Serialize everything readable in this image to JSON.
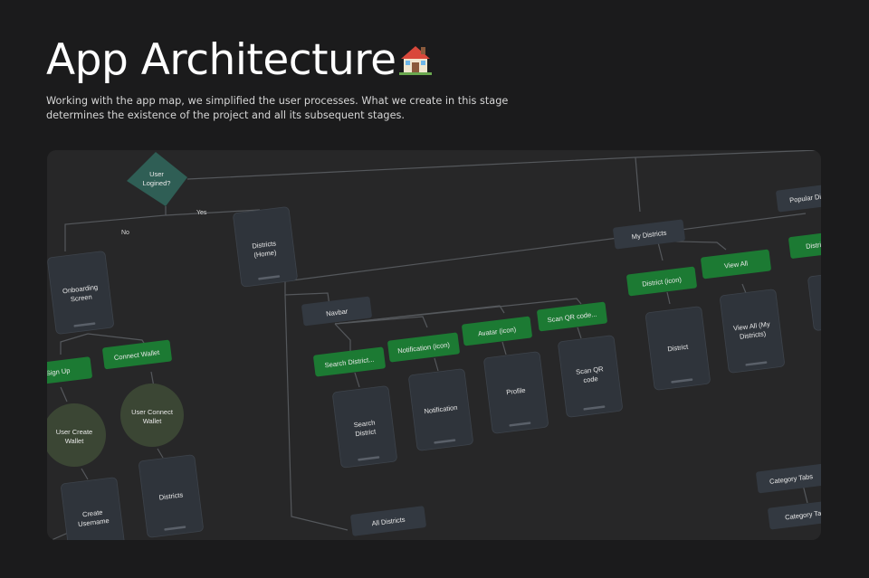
{
  "header": {
    "title": "App Architecture",
    "icon": "house-emoji-icon",
    "description_lines": [
      "Working with the app map, we simplified the user processes. What we create in this stage",
      "determines the existence of the project and all its subsequent stages."
    ]
  },
  "diagram": {
    "decision": [
      "User",
      "Logined?"
    ],
    "edge_no": "No",
    "edge_yes": "Yes",
    "onboarding": [
      "Onboarding",
      "Screen"
    ],
    "sign_up": "Sign Up",
    "connect_wallet": "Connect Wallet",
    "user_create_wallet": [
      "User Create",
      "Wallet"
    ],
    "user_connect_wallet": [
      "User Connect",
      "Wallet"
    ],
    "create_username": [
      "Create",
      "Username"
    ],
    "districts_screen": "Districts",
    "districts_home": [
      "Districts",
      "(Home)"
    ],
    "navbar": "Navbar",
    "search_districts_btn": "Search District...",
    "notification_btn": "Notification (icon)",
    "avatar_btn": "Avatar (icon)",
    "scan_qr_btn": "Scan QR code...",
    "search_district_screen": [
      "Search",
      "District"
    ],
    "notification_screen": "Notification",
    "profile_screen": "Profile",
    "scan_qr_screen": [
      "Scan QR",
      "code"
    ],
    "my_districts": "My Districts",
    "district_icon_btn": "District (icon)",
    "view_all_btn": "View All",
    "district_screen": "District",
    "view_all_screen": [
      "View All (My",
      "Districts)"
    ],
    "popular_districts": "Popular Dis",
    "distri_btn": "Distri",
    "all_districts": "All Districts",
    "category_tabs_1": "Category Tabs",
    "category_tabs_2": "Category Tab",
    "colors": {
      "canvas": "#272728",
      "screen": "#2f343b",
      "green_button": "#1c7a33",
      "dark_button": "#333941",
      "decision": "#2f5e55",
      "circle": "#3b4634",
      "connector": "#55585c"
    }
  }
}
